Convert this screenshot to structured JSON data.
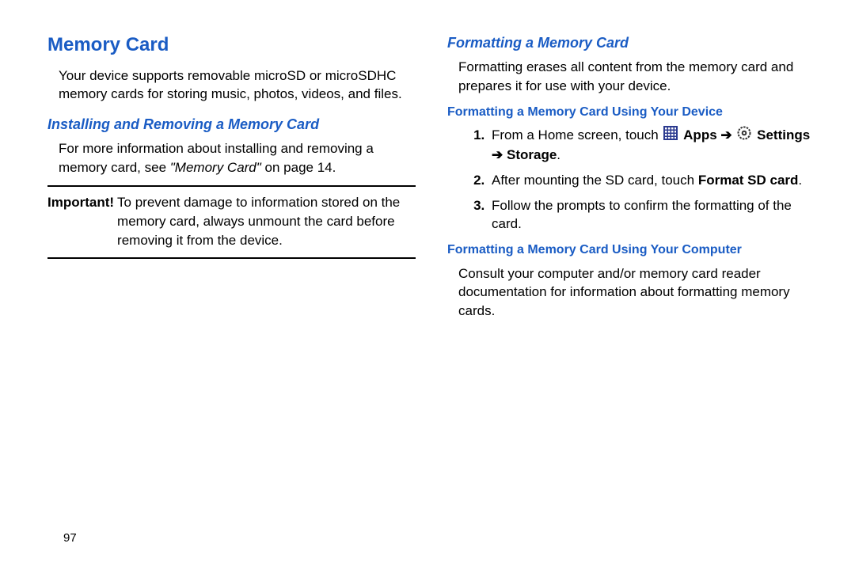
{
  "left": {
    "heading": "Memory Card",
    "intro": "Your device supports removable microSD or microSDHC memory cards for storing music, photos, videos, and files.",
    "subheading1": "Installing and Removing a Memory Card",
    "para1_a": "For more information about installing and removing a memory card, see ",
    "para1_ref": "\"Memory Card\"",
    "para1_b": " on page 14.",
    "note_label": "Important!",
    "note_text": "To prevent damage to information stored on the memory card, always unmount the card before removing it from the device."
  },
  "right": {
    "heading": "Formatting a Memory Card",
    "intro": "Formatting erases all content from the memory card and prepares it for use with your device.",
    "sub1": "Formatting a Memory Card Using Your Device",
    "step1_a": "From a Home screen, touch ",
    "step1_apps": " Apps ",
    "step1_settings": " Settings ",
    "step1_storage": " Storage",
    "step2_a": "After mounting the SD card, touch ",
    "step2_b": "Format SD card",
    "step3": "Follow the prompts to confirm the formatting of the card.",
    "sub2": "Formatting a Memory Card Using Your Computer",
    "para2": "Consult your computer and/or memory card reader documentation for information about formatting memory cards."
  },
  "page_number": "97",
  "icons": {
    "arrow": "➔"
  }
}
